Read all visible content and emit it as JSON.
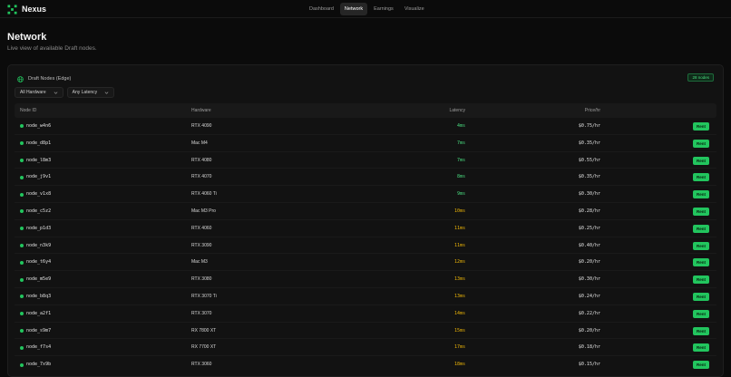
{
  "app": {
    "brand": "Nexus",
    "accent": "#22c55e",
    "nav": [
      "Dashboard",
      "Network",
      "Earnings",
      "Visualize"
    ],
    "active_nav": "Network"
  },
  "page": {
    "title": "Network",
    "subtitle": "Live view of available Draft nodes."
  },
  "card": {
    "title": "Draft Nodes (Edge)",
    "count_badge": "28 nodes",
    "filters": [
      "All Hardware",
      "Any Latency"
    ]
  },
  "table": {
    "columns": [
      "Node ID",
      "Hardware",
      "Latency",
      "Price/hr",
      ""
    ],
    "rows": [
      {
        "id": "node_w4n6",
        "hardware": "RTX 4090",
        "latency": "4ms",
        "tier": "good",
        "price": "$0.75/hr",
        "action": "Rent"
      },
      {
        "id": "node_d8p1",
        "hardware": "Mac M4",
        "latency": "7ms",
        "tier": "good",
        "price": "$0.35/hr",
        "action": "Rent"
      },
      {
        "id": "node_l8m3",
        "hardware": "RTX 4080",
        "latency": "7ms",
        "tier": "good",
        "price": "$0.55/hr",
        "action": "Rent"
      },
      {
        "id": "node_j9v1",
        "hardware": "RTX 4070",
        "latency": "8ms",
        "tier": "good",
        "price": "$0.35/hr",
        "action": "Rent"
      },
      {
        "id": "node_v1x8",
        "hardware": "RTX 4060 Ti",
        "latency": "9ms",
        "tier": "good",
        "price": "$0.30/hr",
        "action": "Rent"
      },
      {
        "id": "node_c5z2",
        "hardware": "Mac M3 Pro",
        "latency": "10ms",
        "tier": "mid",
        "price": "$0.28/hr",
        "action": "Rent"
      },
      {
        "id": "node_p1d3",
        "hardware": "RTX 4060",
        "latency": "11ms",
        "tier": "mid",
        "price": "$0.25/hr",
        "action": "Rent"
      },
      {
        "id": "node_n3k9",
        "hardware": "RTX 3090",
        "latency": "11ms",
        "tier": "mid",
        "price": "$0.40/hr",
        "action": "Rent"
      },
      {
        "id": "node_t6y4",
        "hardware": "Mac M3",
        "latency": "12ms",
        "tier": "mid",
        "price": "$0.20/hr",
        "action": "Rent"
      },
      {
        "id": "node_m5e9",
        "hardware": "RTX 3080",
        "latency": "13ms",
        "tier": "mid",
        "price": "$0.30/hr",
        "action": "Rent"
      },
      {
        "id": "node_b8q3",
        "hardware": "RTX 3070 Ti",
        "latency": "13ms",
        "tier": "mid",
        "price": "$0.24/hr",
        "action": "Rent"
      },
      {
        "id": "node_a2f1",
        "hardware": "RTX 3070",
        "latency": "14ms",
        "tier": "mid",
        "price": "$0.22/hr",
        "action": "Rent"
      },
      {
        "id": "node_s9m7",
        "hardware": "RX 7800 XT",
        "latency": "15ms",
        "tier": "mid",
        "price": "$0.20/hr",
        "action": "Rent"
      },
      {
        "id": "node_f7s4",
        "hardware": "RX 7700 XT",
        "latency": "17ms",
        "tier": "mid",
        "price": "$0.18/hr",
        "action": "Rent"
      },
      {
        "id": "node_7x9b",
        "hardware": "RTX 3060",
        "latency": "18ms",
        "tier": "mid",
        "price": "$0.15/hr",
        "action": "Rent"
      }
    ]
  }
}
